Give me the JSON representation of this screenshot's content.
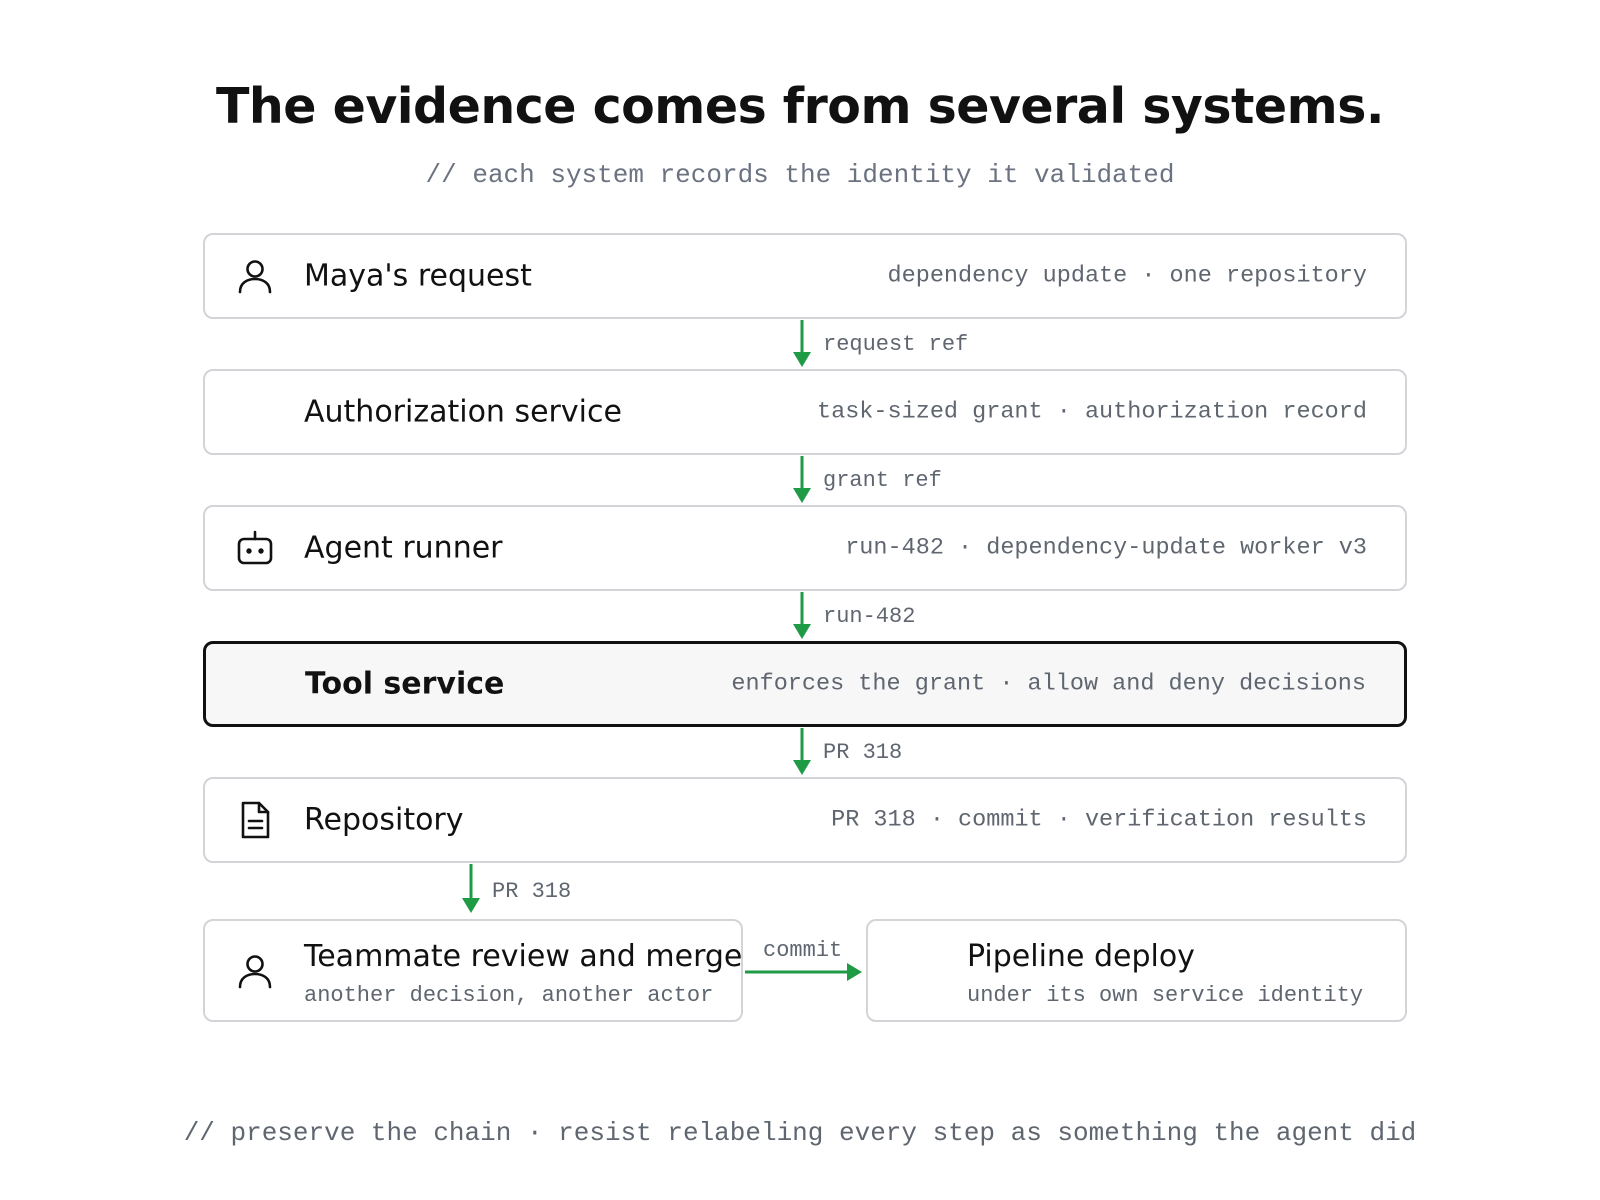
{
  "title": "The evidence comes from several systems.",
  "subtitle": "// each system records the identity it validated",
  "colors": {
    "arrow": "#1f9a45",
    "node_border": "#d4d4d8",
    "highlight_border": "#111111",
    "muted_text": "#5f6670"
  },
  "nodes": [
    {
      "label": "Maya's request",
      "meta": "dependency update · one repository",
      "icon": "user-icon"
    },
    {
      "label": "Authorization service",
      "meta": "task-sized grant · authorization record",
      "icon": ""
    },
    {
      "label": "Agent runner",
      "meta": "run-482 · dependency-update worker v3",
      "icon": "robot-icon"
    },
    {
      "label": "Tool service",
      "meta": "enforces the grant · allow and deny decisions",
      "icon": "",
      "highlighted": true
    },
    {
      "label": "Repository",
      "meta": "PR 318 · commit · verification results",
      "icon": "document-icon"
    }
  ],
  "bottom_nodes": [
    {
      "label": "Teammate review and merge",
      "sub": "another decision, another actor",
      "icon": "user-icon"
    },
    {
      "label": "Pipeline deploy",
      "sub": "under its own service identity",
      "icon": ""
    }
  ],
  "connectors": [
    {
      "from": "Maya's request",
      "to": "Authorization service",
      "label": "request ref"
    },
    {
      "from": "Authorization service",
      "to": "Agent runner",
      "label": "grant ref"
    },
    {
      "from": "Agent runner",
      "to": "Tool service",
      "label": "run-482"
    },
    {
      "from": "Tool service",
      "to": "Repository",
      "label": "PR 318"
    },
    {
      "from": "Repository",
      "to": "Teammate review and merge",
      "label": "PR 318"
    },
    {
      "from": "Teammate review and merge",
      "to": "Pipeline deploy",
      "label": "commit"
    }
  ],
  "footer": "// preserve the chain · resist relabeling every step as something the agent did"
}
